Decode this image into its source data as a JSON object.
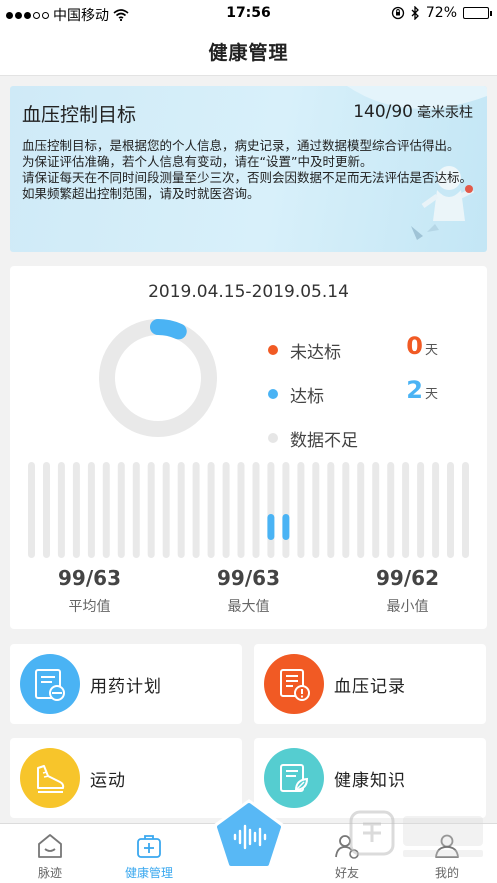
{
  "status_bar": {
    "carrier": "中国移动",
    "time": "17:56",
    "battery": "72%",
    "battery_level": 0.72
  },
  "header": {
    "title": "健康管理"
  },
  "target": {
    "title": "血压控制目标",
    "value": "140/90",
    "unit": "毫米汞柱",
    "desc": [
      "血压控制目标，是根据您的个人信息，病史记录，通过数据模型综合评估得出。",
      "为保证评估准确，若个人信息有变动，请在“设置”中及时更新。",
      "请保证每天在不同时间段测量至少三次，否则会因数据不足而无法评估是否达标。",
      "如果频繁超出控制范围，请及时就医咨询。"
    ]
  },
  "stats": {
    "date_range": "2019.04.15-2019.05.14",
    "legend": [
      {
        "label": "未达标",
        "value": "0",
        "suffix": "天",
        "color": "#f15a24"
      },
      {
        "label": "达标",
        "value": "2",
        "suffix": "天",
        "color": "#4ab3f4"
      },
      {
        "label": "数据不足",
        "value": "",
        "suffix": "",
        "color": "#e6e6e6"
      }
    ],
    "donut": {
      "days_total": 30,
      "days_ok": 2,
      "days_not_ok": 0
    },
    "bars": {
      "count": 30,
      "highlight": [
        16,
        17
      ]
    },
    "readings": [
      {
        "value": "99/63",
        "label": "平均值"
      },
      {
        "value": "99/63",
        "label": "最大值"
      },
      {
        "value": "99/62",
        "label": "最小值"
      }
    ]
  },
  "tiles": [
    {
      "label": "用药计划",
      "icon": "medication-plan-icon",
      "color": "#4ab3f4"
    },
    {
      "label": "血压记录",
      "icon": "bp-record-icon",
      "color": "#f15a24"
    },
    {
      "label": "运动",
      "icon": "sport-shoe-icon",
      "color": "#f7c52b"
    },
    {
      "label": "健康知识",
      "icon": "health-knowledge-icon",
      "color": "#55cdd0"
    }
  ],
  "tabbar": {
    "tabs": [
      {
        "label": "脉迹",
        "icon": "home-icon",
        "active": false
      },
      {
        "label": "健康管理",
        "icon": "medical-kit-icon",
        "active": true
      },
      {
        "label": "好友",
        "icon": "friends-icon",
        "active": false
      },
      {
        "label": "我的",
        "icon": "profile-icon",
        "active": false
      }
    ],
    "center_icon": "voice-wave-icon"
  },
  "colors": {
    "accent": "#3aa8ef",
    "warning": "#f15a24",
    "bar_gray": "#e9e9e9"
  }
}
